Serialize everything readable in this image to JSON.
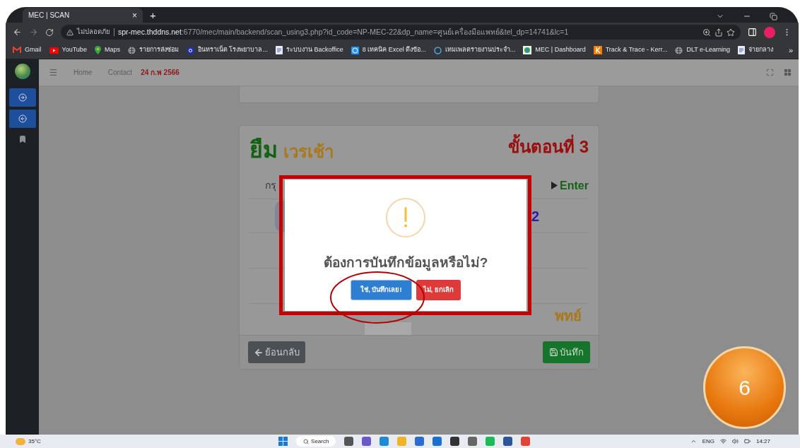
{
  "browser": {
    "tab": {
      "title": "MEC | SCAN",
      "close": "×",
      "new_tab": "+"
    },
    "address": {
      "security": "ไม่ปลอดภัย",
      "host": "spr-mec.thddns.net",
      "path": ":6770/mec/main/backend/scan_using3.php?id_code=NP-MEC-22&dp_name=ศูนย์เครื่องมือแพทย์&tel_dp=14741&lc=1"
    },
    "bookmarks": [
      {
        "kind": "gmail",
        "label": "Gmail"
      },
      {
        "kind": "youtube",
        "label": "YouTube"
      },
      {
        "kind": "pin",
        "label": "Maps"
      },
      {
        "kind": "globe",
        "label": "รายการส่งซ่อม"
      },
      {
        "kind": "badge",
        "label": "อินทราเน็ต โรงพยาบาล..."
      },
      {
        "kind": "page",
        "label": "ระบบงาน Backoffice"
      },
      {
        "kind": "wp",
        "label": "8 เทคนิค Excel ดึงข้อ..."
      },
      {
        "kind": "ring",
        "label": "เทมเพลตรายงานประจำ..."
      },
      {
        "kind": "grid",
        "label": "MEC | Dashboard"
      },
      {
        "kind": "k",
        "label": "Track & Trace - Kerr..."
      },
      {
        "kind": "globe",
        "label": "DLT e-Learning"
      },
      {
        "kind": "page",
        "label": "จ่ายกลาง"
      }
    ],
    "bookmarks_overflow": "»"
  },
  "navbar": {
    "links": [
      "Home",
      "Contact"
    ],
    "date": "24 ก.พ 2566"
  },
  "card": {
    "title": "ยืม",
    "shift": "เวรเช้า",
    "step": "ขั้นตอนที่ 3",
    "prompt_fragment": "กรุ",
    "enter_hint": "Enter",
    "code_fragment": "2",
    "department_fragment": "พทย์",
    "back_button": "ย้อนกลับ",
    "save_button": "บันทึก"
  },
  "dialog": {
    "message": "ต้องการบันทึกข้อมูลหรือไม่?",
    "confirm_button": "ใช่, บันทึกเลย!",
    "cancel_button": "ไม่, ยกเลิก"
  },
  "annotation": {
    "step_badge": "6"
  },
  "taskbar": {
    "weather": "35°C",
    "search": "Search",
    "language": "ENG",
    "time": "14:27"
  }
}
